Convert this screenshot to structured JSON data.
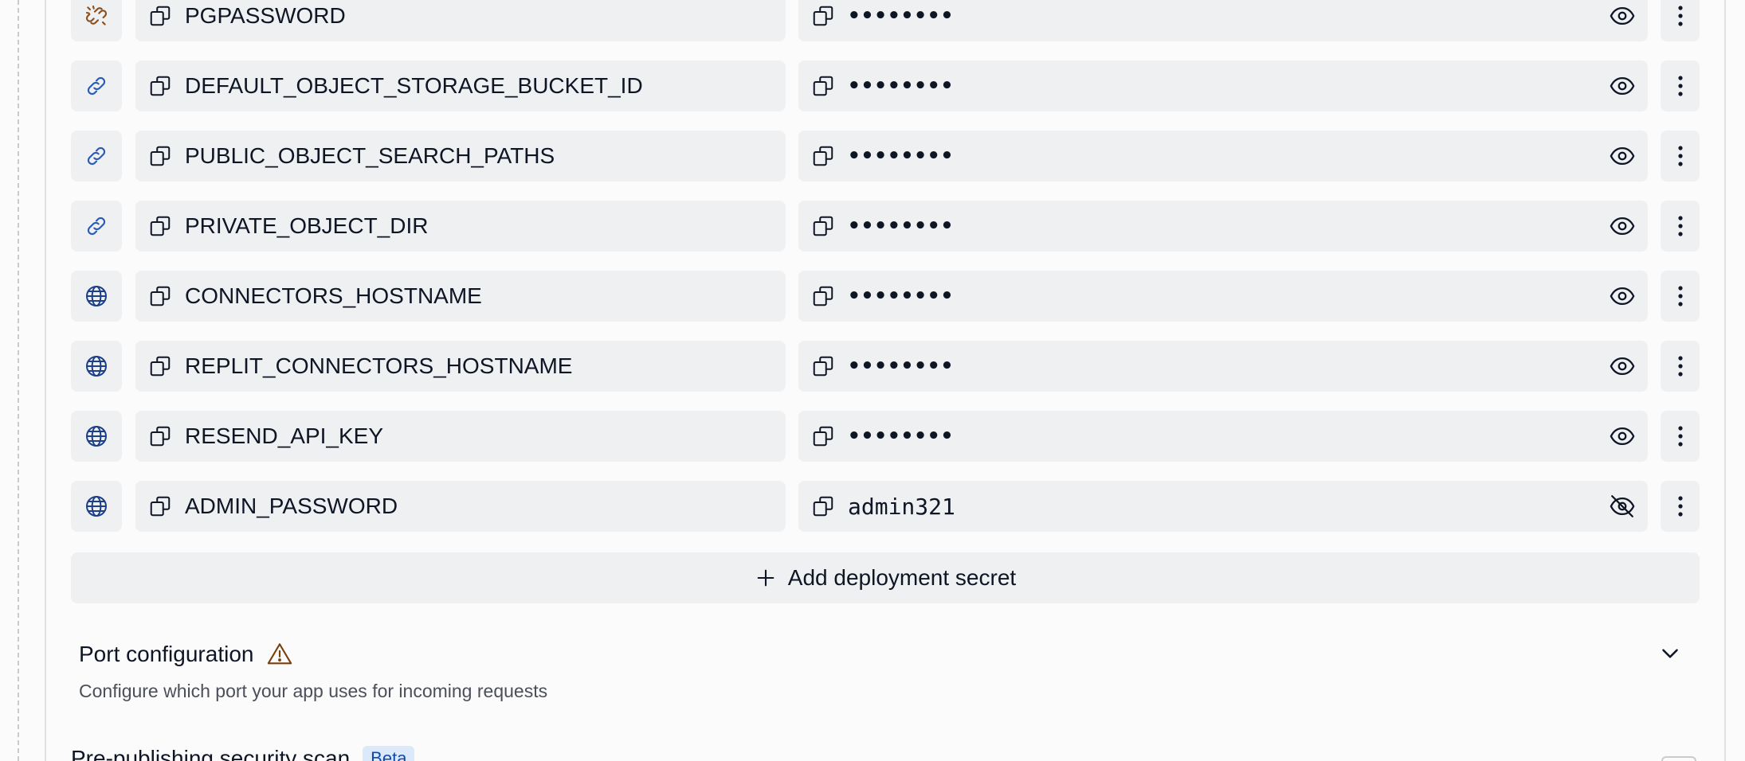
{
  "colors": {
    "field_bg": "#eff0f2",
    "text": "#0e1525",
    "muted": "#4b4f59",
    "link_icon_blue": "#2a5bb8",
    "broken_link_icon": "#8a4f1d",
    "globe_icon": "#1d3f8a",
    "beta_bg": "#dbe9fb",
    "beta_text": "#0f4aa8",
    "warning": "#7a3f0f"
  },
  "secrets": [
    {
      "type_icon": "unlink-icon",
      "key": "PGPASSWORD",
      "value": "••••••••",
      "masked": true
    },
    {
      "type_icon": "link-icon",
      "key": "DEFAULT_OBJECT_STORAGE_BUCKET_ID",
      "value": "••••••••",
      "masked": true
    },
    {
      "type_icon": "link-icon",
      "key": "PUBLIC_OBJECT_SEARCH_PATHS",
      "value": "••••••••",
      "masked": true
    },
    {
      "type_icon": "link-icon",
      "key": "PRIVATE_OBJECT_DIR",
      "value": "••••••••",
      "masked": true
    },
    {
      "type_icon": "globe-icon",
      "key": "CONNECTORS_HOSTNAME",
      "value": "••••••••",
      "masked": true
    },
    {
      "type_icon": "globe-icon",
      "key": "REPLIT_CONNECTORS_HOSTNAME",
      "value": "••••••••",
      "masked": true
    },
    {
      "type_icon": "globe-icon",
      "key": "RESEND_API_KEY",
      "value": "••••••••",
      "masked": true
    },
    {
      "type_icon": "globe-icon",
      "key": "ADMIN_PASSWORD",
      "value": "admin321",
      "masked": false
    }
  ],
  "add_secret": {
    "label": "Add deployment secret",
    "icon": "plus-icon"
  },
  "port_config": {
    "title": "Port configuration",
    "description": "Configure which port your app uses for incoming requests",
    "warning_icon": "warning-icon",
    "toggle_icon": "chevron-down-icon"
  },
  "security_scan": {
    "title": "Pre-publishing security scan",
    "badge": "Beta"
  }
}
